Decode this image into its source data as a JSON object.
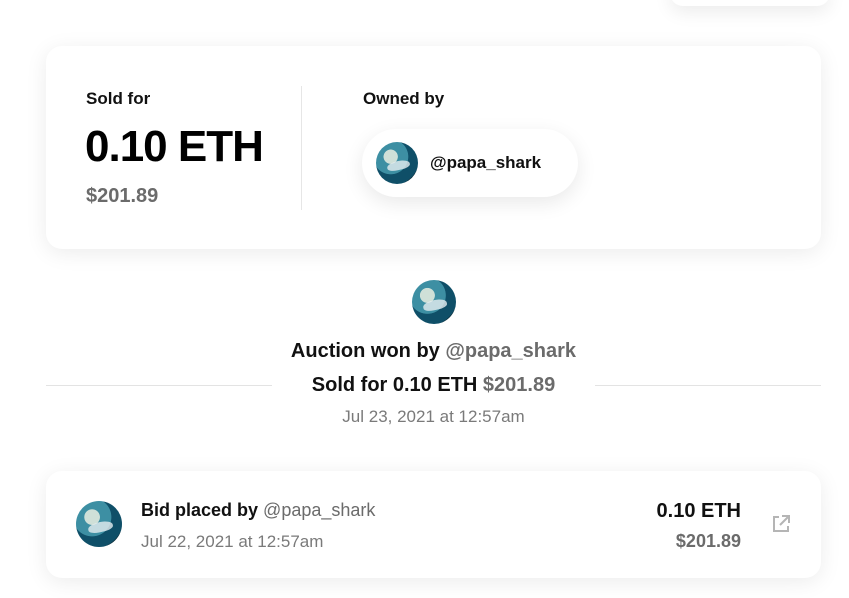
{
  "sold_card": {
    "sold_label": "Sold for",
    "price_eth": "0.10 ETH",
    "price_usd": "$201.89",
    "owned_label": "Owned by",
    "owner_handle": "@papa_shark"
  },
  "auction_event": {
    "won_prefix": "Auction won by",
    "won_handle": "@papa_shark",
    "sold_prefix": "Sold for 0.10 ETH",
    "sold_usd": "$201.89",
    "date": "Jul 23, 2021 at 12:57am"
  },
  "bid_event": {
    "bid_prefix": "Bid placed by",
    "bid_handle": "@papa_shark",
    "date": "Jul 22, 2021 at 12:57am",
    "amount_eth": "0.10 ETH",
    "amount_usd": "$201.89",
    "link_icon": "external-link-icon"
  },
  "colors": {
    "text": "#111111",
    "muted": "#6b6b6b",
    "divider": "#e3e3e3"
  }
}
